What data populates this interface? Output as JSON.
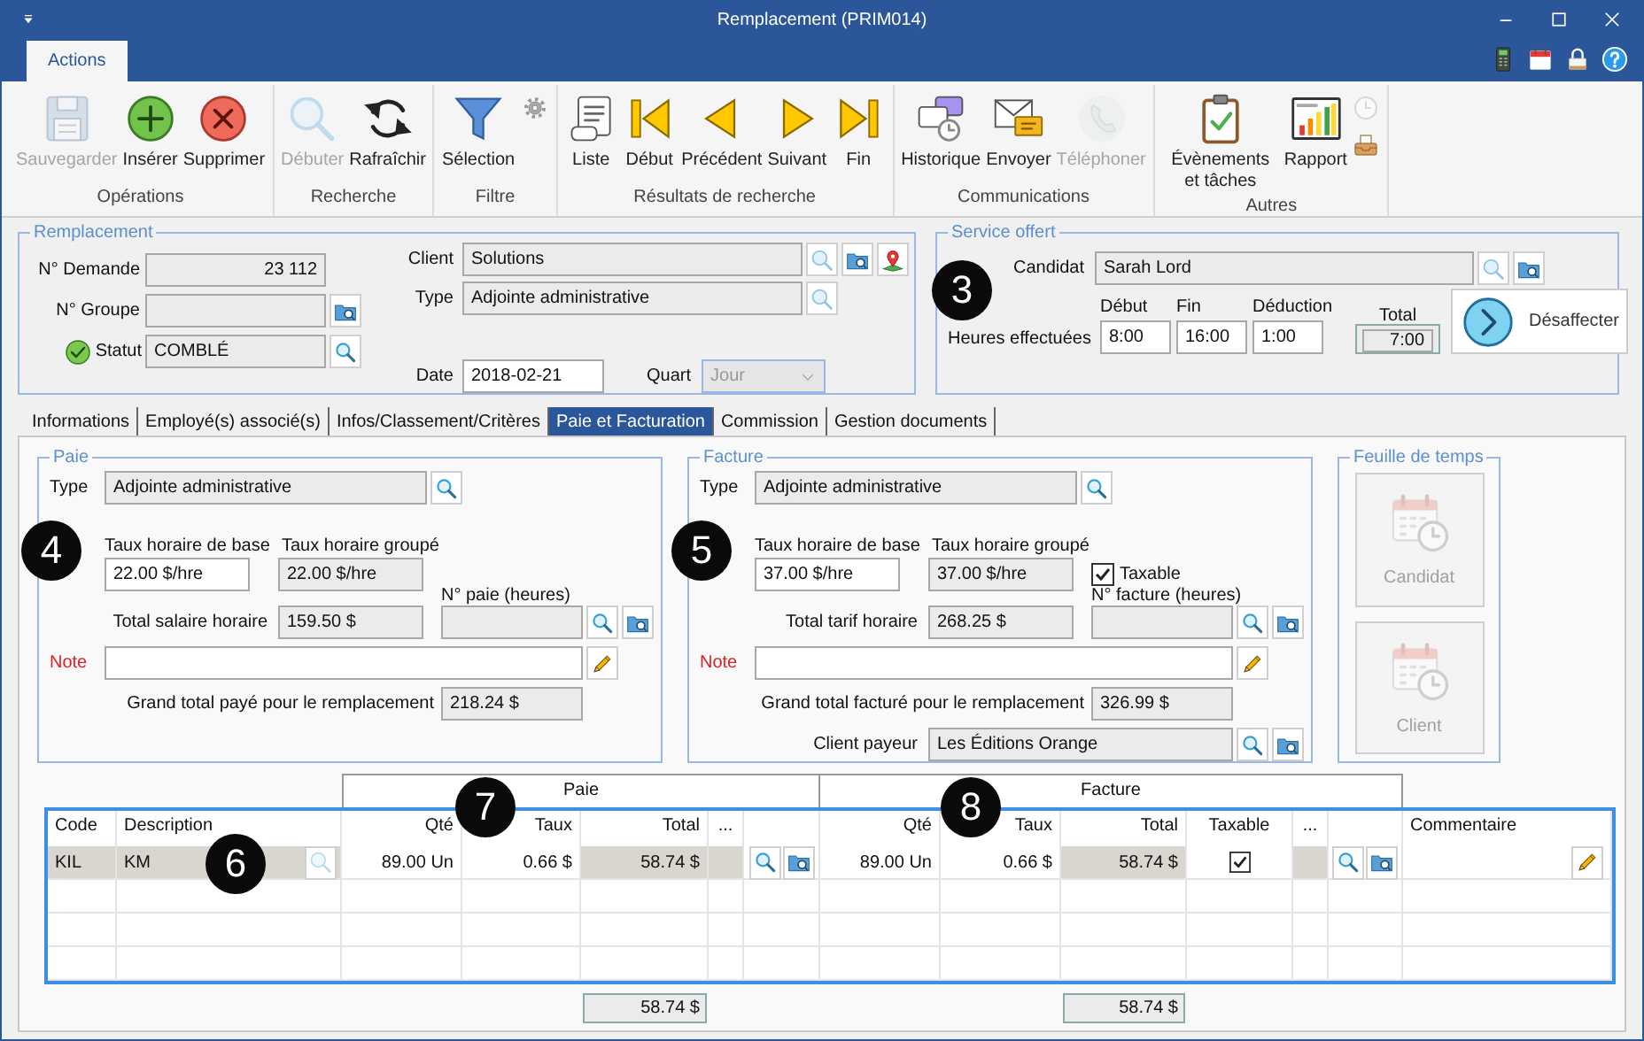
{
  "window": {
    "title": "Remplacement (PRIM014)"
  },
  "ribbon_tabs": [
    {
      "label": "Actions",
      "selected": true
    }
  ],
  "ribbon_groups": [
    {
      "label": "Opérations",
      "buttons": [
        {
          "kind": "save",
          "label": "Sauvegarder",
          "disabled": true
        },
        {
          "kind": "add",
          "label": "Insérer",
          "disabled": false
        },
        {
          "kind": "del",
          "label": "Supprimer",
          "disabled": false
        }
      ]
    },
    {
      "label": "Recherche",
      "buttons": [
        {
          "kind": "search",
          "label": "Débuter",
          "disabled": true
        },
        {
          "kind": "refresh",
          "label": "Rafraîchir",
          "disabled": false
        }
      ]
    },
    {
      "label": "Filtre",
      "buttons": [
        {
          "kind": "filter",
          "label": "Sélection",
          "disabled": false
        }
      ],
      "extras": [
        {
          "kind": "gear",
          "disabled": false
        }
      ]
    },
    {
      "label": "Résultats de recherche",
      "buttons": [
        {
          "kind": "scroll",
          "label": "Liste",
          "disabled": false
        },
        {
          "kind": "first",
          "label": "Début",
          "disabled": false
        },
        {
          "kind": "prev",
          "label": "Précédent",
          "disabled": false
        },
        {
          "kind": "next",
          "label": "Suivant",
          "disabled": false
        },
        {
          "kind": "last",
          "label": "Fin",
          "disabled": false
        }
      ]
    },
    {
      "label": "Communications",
      "buttons": [
        {
          "kind": "history",
          "label": "Historique",
          "disabled": false
        },
        {
          "kind": "send",
          "label": "Envoyer",
          "disabled": false
        },
        {
          "kind": "phone",
          "label": "Téléphoner",
          "disabled": true
        }
      ]
    },
    {
      "label": "Autres",
      "buttons": [
        {
          "kind": "events",
          "label": "Évènements et tâches",
          "disabled": false
        },
        {
          "kind": "report",
          "label": "Rapport",
          "disabled": false
        }
      ],
      "extras": [
        {
          "kind": "clock",
          "disabled": true
        },
        {
          "kind": "inbox",
          "disabled": false
        }
      ]
    }
  ],
  "remplacement": {
    "title": "Remplacement",
    "demande": {
      "label": "N° Demande",
      "value": "23 112",
      "readonly": true
    },
    "groupe": {
      "label": "N° Groupe",
      "readonly": true
    },
    "statut": {
      "label": "Statut",
      "value": "COMBLÉ",
      "readonly": true
    },
    "client": {
      "label": "Client",
      "value": "Solutions",
      "readonly": true
    },
    "type": {
      "label": "Type",
      "value": "Adjointe administrative",
      "readonly": true
    },
    "date": {
      "label": "Date",
      "value": "2018-02-21",
      "readonly": false
    },
    "quart": {
      "label": "Quart",
      "value": "Jour",
      "disabled": true
    }
  },
  "service": {
    "title": "Service offert",
    "callout": "3",
    "candidat": {
      "label": "Candidat",
      "value": "Sarah Lord",
      "readonly": true
    },
    "hours_label": "Heures effectuées",
    "hours": [
      {
        "label": "Début",
        "value": "8:00",
        "readonly": false
      },
      {
        "label": "Fin",
        "value": "16:00",
        "readonly": false
      },
      {
        "label": "Déduction",
        "value": "1:00",
        "readonly": false
      },
      {
        "label": "Total",
        "value": "7:00",
        "readonly": true
      }
    ],
    "action": {
      "label": "Désaffecter"
    }
  },
  "tabs": [
    {
      "label": "Informations",
      "selected": false
    },
    {
      "label": "Employé(s) associé(s)",
      "selected": false
    },
    {
      "label": "Infos/Classement/Critères",
      "selected": false
    },
    {
      "label": "Paie et Facturation",
      "selected": true
    },
    {
      "label": "Commission",
      "selected": false
    },
    {
      "label": "Gestion documents",
      "selected": false
    }
  ],
  "billing": [
    {
      "title": "Paie",
      "callout": "4",
      "type": {
        "label": "Type",
        "value": "Adjointe administrative"
      },
      "base_rate": {
        "label": "Taux horaire de base",
        "value": "22.00 $/hre"
      },
      "group_rate": {
        "label": "Taux horaire groupé",
        "value": "22.00 $/hre"
      },
      "number": {
        "label": "N° paie (heures)"
      },
      "hourly_total": {
        "label": "Total salaire horaire",
        "value": "159.50 $"
      },
      "note": {
        "label": "Note"
      },
      "grand_total": {
        "label": "Grand total payé pour le remplacement",
        "value": "218.24 $"
      }
    },
    {
      "title": "Facture",
      "callout": "5",
      "type": {
        "label": "Type",
        "value": "Adjointe administrative"
      },
      "base_rate": {
        "label": "Taux horaire de base",
        "value": "37.00 $/hre"
      },
      "group_rate": {
        "label": "Taux horaire groupé",
        "value": "37.00 $/hre"
      },
      "taxable": {
        "label": "Taxable",
        "checked": true
      },
      "number": {
        "label": "N° facture (heures)"
      },
      "hourly_total": {
        "label": "Total tarif horaire",
        "value": "268.25 $"
      },
      "note": {
        "label": "Note"
      },
      "grand_total": {
        "label": "Grand total facturé pour le remplacement",
        "value": "326.99 $"
      },
      "payer": {
        "label": "Client payeur",
        "value": "Les Éditions Orange"
      }
    }
  ],
  "timesheet": {
    "title": "Feuille de temps",
    "buttons": [
      {
        "label": "Candidat",
        "disabled": true
      },
      {
        "label": "Client",
        "disabled": true
      }
    ]
  },
  "lines": {
    "groups": [
      {
        "label": "Paie"
      },
      {
        "label": "Facture"
      }
    ],
    "columns": [
      {
        "label": "Code"
      },
      {
        "label": "Description"
      },
      {
        "label": "Qté"
      },
      {
        "label": "Taux"
      },
      {
        "label": "Total"
      },
      {
        "label": "..."
      },
      {
        "kind": "tools"
      },
      {
        "label": "Qté"
      },
      {
        "label": "Taux"
      },
      {
        "label": "Total"
      },
      {
        "label": "Taxable"
      },
      {
        "label": "..."
      },
      {
        "kind": "tools"
      },
      {
        "label": "Commentaire"
      }
    ],
    "rows": [
      {
        "cells": [
          {
            "kind": "text",
            "value": "KIL",
            "readonly": true
          },
          {
            "kind": "lookup",
            "value": "KM",
            "readonly": true
          },
          {
            "kind": "text",
            "value": "89.00 Un",
            "readonly": false
          },
          {
            "kind": "text",
            "value": "0.66 $",
            "readonly": false
          },
          {
            "kind": "text",
            "value": "58.74 $",
            "readonly": true
          },
          {
            "kind": "blank",
            "readonly": true
          },
          {
            "kind": "tools"
          },
          {
            "kind": "text",
            "value": "89.00 Un",
            "readonly": false
          },
          {
            "kind": "text",
            "value": "0.66 $",
            "readonly": false
          },
          {
            "kind": "text",
            "value": "58.74 $",
            "readonly": true
          },
          {
            "kind": "check",
            "checked": true
          },
          {
            "kind": "blank",
            "readonly": true
          },
          {
            "kind": "tools"
          },
          {
            "kind": "edit"
          }
        ]
      }
    ],
    "totals": [
      {
        "value": "58.74 $"
      },
      {
        "value": "58.74 $"
      }
    ],
    "callouts": [
      "6",
      "7",
      "8"
    ]
  }
}
